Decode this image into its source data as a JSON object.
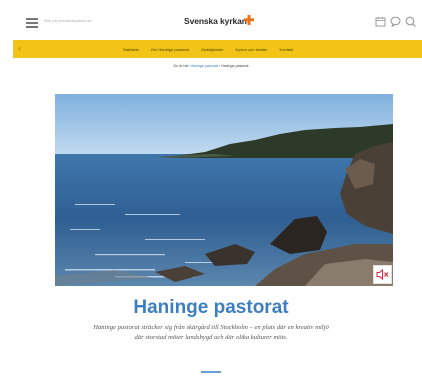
{
  "header": {
    "search_text": "Sök på svenskakyrkan.se",
    "brand_name": "Svenska kyrkan",
    "menu_icon": "hamburger-icon",
    "icons": [
      "calendar-icon",
      "chat-icon",
      "search-icon"
    ],
    "brand_color": "#f2c417",
    "cross_color": "#e8731b"
  },
  "nav": {
    "back_glyph": "‹",
    "items": [
      "Startsida",
      "Om Haninge pastorat",
      "Gudstjänster",
      "Kyrkor och lokaler",
      "Kontakt"
    ]
  },
  "breadcrumb": {
    "prefix": "Du är här:",
    "link": "Haninge pastorat",
    "separator": "›",
    "current": "Haninge pastorat"
  },
  "hero": {
    "sound_icon": "speaker-icon"
  },
  "content": {
    "title": "Haninge pastorat",
    "intro": "Haninge pastorat sträcker sig från skärgård till Stockholm – en plats där en kreativ miljö där storstad möter landsbygd och där olika kulturer möts."
  }
}
